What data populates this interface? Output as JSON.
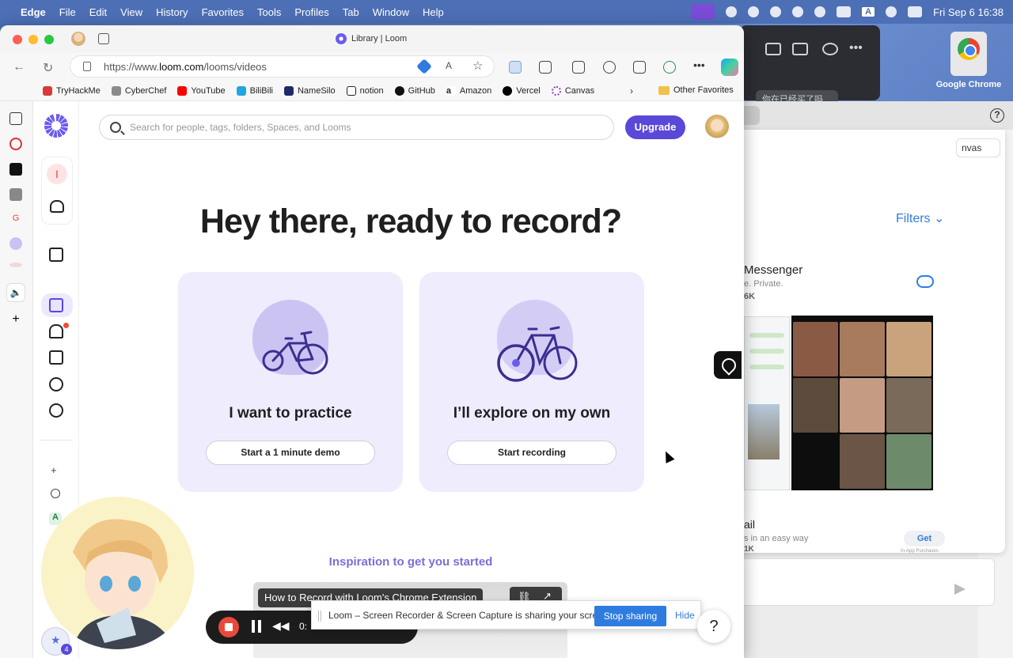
{
  "menubar": {
    "app": "Edge",
    "items": [
      "File",
      "Edit",
      "View",
      "History",
      "Favorites",
      "Tools",
      "Profiles",
      "Tab",
      "Window",
      "Help"
    ],
    "datetime": "Fri Sep 6  16:38",
    "input_source": "A"
  },
  "desktop": {
    "chrome_label": "Google Chrome",
    "dark_window_chat": "你在已经买了吗"
  },
  "appstore": {
    "help": "?",
    "canvas_btn": "nvas",
    "filters": "Filters",
    "app1": {
      "title": "Messenger",
      "subtitle": "e. Private.",
      "count": "6K"
    },
    "app2": {
      "title": "ail",
      "subtitle": "s in an easy way",
      "count": "1K",
      "get": "Get",
      "note": "In-App Purchases"
    }
  },
  "browser": {
    "tab_title": "Library | Loom",
    "url_prefix": "https://www.",
    "url_domain": "loom.com",
    "url_path": "/looms/videos",
    "favorites": [
      {
        "label": "TryHackMe",
        "color": "#d83a3a"
      },
      {
        "label": "CyberChef",
        "color": "#8a8a8a"
      },
      {
        "label": "YouTube",
        "color": "#ff0000"
      },
      {
        "label": "BiliBili",
        "color": "#22a5e0"
      },
      {
        "label": "NameSilo",
        "color": "#1f2a6b"
      },
      {
        "label": "notion",
        "color": "#222222"
      },
      {
        "label": "GitHub",
        "color": "#111111"
      },
      {
        "label": "Amazon",
        "color": "#222222"
      },
      {
        "label": "Vercel",
        "color": "#000000"
      },
      {
        "label": "Canvas",
        "color": "#8a3cc4"
      }
    ],
    "favorites_more": "›",
    "other_favorites": "Other Favorites"
  },
  "loom": {
    "workspace_initial": "I",
    "search_placeholder": "Search for people, tags, folders, Spaces, and Looms",
    "upgrade": "Upgrade",
    "hero": "Hey there, ready to record?",
    "card1": {
      "title": "I want to practice",
      "button": "Start a 1 minute demo"
    },
    "card2": {
      "title": "I’ll explore on my own",
      "button": "Start recording"
    },
    "inspiration": "Inspiration to get you started",
    "video_title": "How to Record with Loom's Chrome Extension",
    "nav_small": [
      "+",
      "A"
    ],
    "badge_count": "4",
    "help": "?"
  },
  "recorder": {
    "time": "0:"
  },
  "share_notice": {
    "text": "Loom – Screen Recorder & Screen Capture is sharing your screen.",
    "stop": "Stop sharing",
    "hide": "Hide"
  },
  "colors": {
    "loom_purple": "#5a48d8",
    "card_bg": "#eeecfd",
    "stop_blue": "#2f7ce0"
  }
}
